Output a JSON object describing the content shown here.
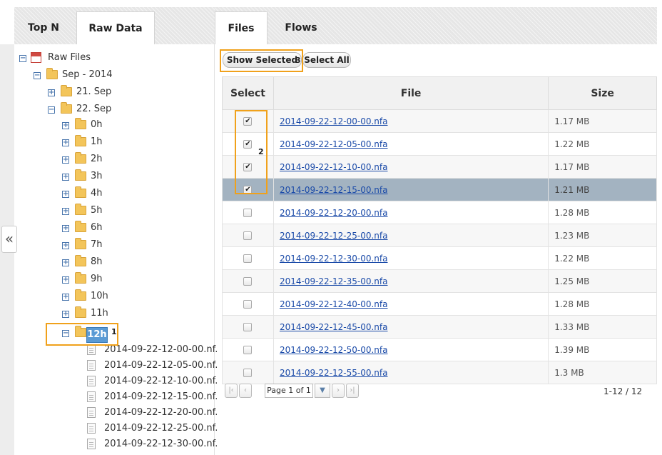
{
  "left_tabs": [
    {
      "label": "Top N"
    },
    {
      "label": "Raw Data"
    }
  ],
  "right_tabs": [
    {
      "label": "Files"
    },
    {
      "label": "Flows"
    }
  ],
  "collapse_icon": "«",
  "tree": {
    "root": "Raw Files",
    "month": "Sep - 2014",
    "day1": "21. Sep",
    "day2": "22. Sep",
    "hours": [
      "0h",
      "1h",
      "2h",
      "3h",
      "4h",
      "5h",
      "6h",
      "7h",
      "8h",
      "9h",
      "10h",
      "11h"
    ],
    "selected_hour": "12h",
    "files": [
      "2014-09-22-12-00-00.nf.",
      "2014-09-22-12-05-00.nf.",
      "2014-09-22-12-10-00.nf.",
      "2014-09-22-12-15-00.nf.",
      "2014-09-22-12-20-00.nf.",
      "2014-09-22-12-25-00.nf.",
      "2014-09-22-12-30-00.nf."
    ]
  },
  "toolbar": {
    "show_selected": "Show Selected",
    "select_all": "Select All"
  },
  "table": {
    "headers": {
      "select": "Select",
      "file": "File",
      "size": "Size"
    },
    "rows": [
      {
        "file": "2014-09-22-12-00-00.nfa",
        "size": "1.17 MB",
        "checked": true
      },
      {
        "file": "2014-09-22-12-05-00.nfa",
        "size": "1.22 MB",
        "checked": true
      },
      {
        "file": "2014-09-22-12-10-00.nfa",
        "size": "1.17 MB",
        "checked": true
      },
      {
        "file": "2014-09-22-12-15-00.nfa",
        "size": "1.21 MB",
        "checked": true
      },
      {
        "file": "2014-09-22-12-20-00.nfa",
        "size": "1.28 MB",
        "checked": false
      },
      {
        "file": "2014-09-22-12-25-00.nfa",
        "size": "1.23 MB",
        "checked": false
      },
      {
        "file": "2014-09-22-12-30-00.nfa",
        "size": "1.22 MB",
        "checked": false
      },
      {
        "file": "2014-09-22-12-35-00.nfa",
        "size": "1.25 MB",
        "checked": false
      },
      {
        "file": "2014-09-22-12-40-00.nfa",
        "size": "1.28 MB",
        "checked": false
      },
      {
        "file": "2014-09-22-12-45-00.nfa",
        "size": "1.33 MB",
        "checked": false
      },
      {
        "file": "2014-09-22-12-50-00.nfa",
        "size": "1.39 MB",
        "checked": false
      },
      {
        "file": "2014-09-22-12-55-00.nfa",
        "size": "1.3 MB",
        "checked": false
      }
    ]
  },
  "pager": {
    "page_text": "Page 1 of 1",
    "count": "1-12 / 12"
  },
  "badges": {
    "b1": "1",
    "b2": "2",
    "b3": "3"
  },
  "colors": {
    "highlight_box": "#f0a11b",
    "selected_row": "#a3b3c1",
    "selected_node": "#5b9bd5",
    "link": "#1a4aa8"
  }
}
